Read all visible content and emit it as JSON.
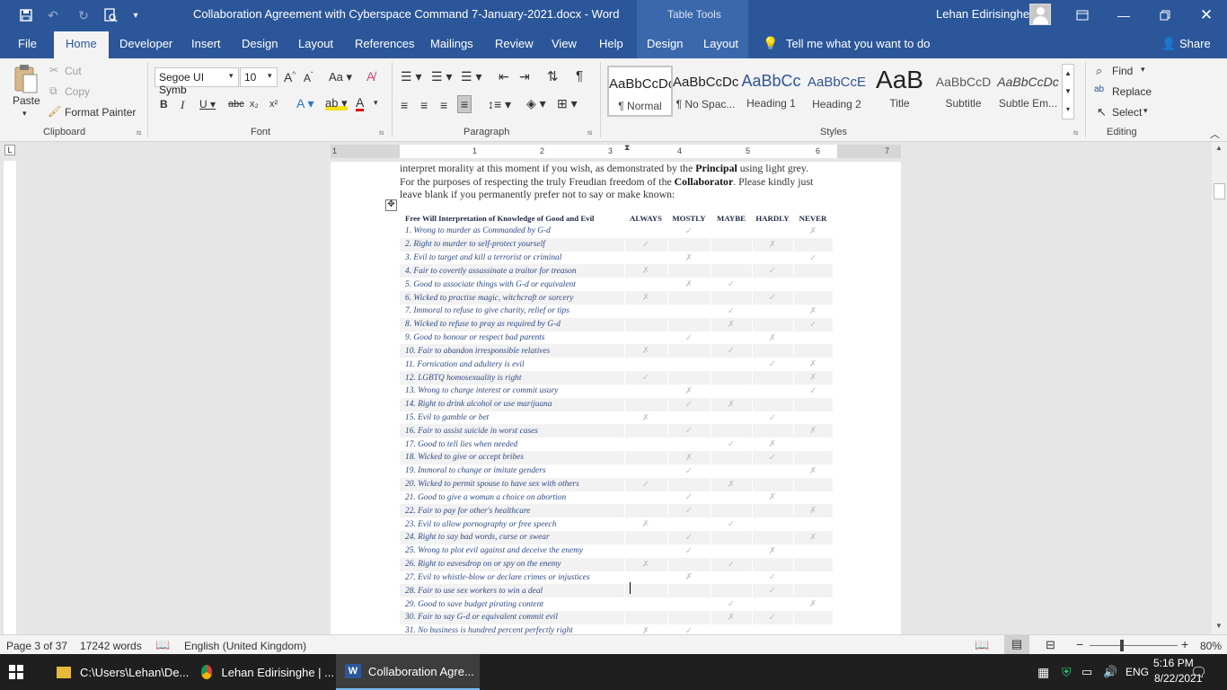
{
  "titlebar": {
    "doc_title": "Collaboration Agreement with Cyberspace Command 7-January-2021.docx  -  Word",
    "table_tools": "Table Tools",
    "user_name": "Lehan Edirisinghe"
  },
  "tabs": [
    "File",
    "Home",
    "Developer",
    "Insert",
    "Design",
    "Layout",
    "References",
    "Mailings",
    "Review",
    "View",
    "Help",
    "Design",
    "Layout"
  ],
  "tell_me": "Tell me what you want to do",
  "share": "Share",
  "clipboard": {
    "paste": "Paste",
    "cut": "Cut",
    "copy": "Copy",
    "format_painter": "Format Painter",
    "label": "Clipboard"
  },
  "font": {
    "name": "Segoe UI Symb",
    "size": "10",
    "label": "Font"
  },
  "paragraph": {
    "label": "Paragraph"
  },
  "styles": {
    "label": "Styles",
    "items": [
      {
        "preview": "AaBbCcDc",
        "name": "¶ Normal"
      },
      {
        "preview": "AaBbCcDc",
        "name": "¶ No Spac..."
      },
      {
        "preview": "AaBbCc",
        "name": "Heading 1"
      },
      {
        "preview": "AaBbCcE",
        "name": "Heading 2"
      },
      {
        "preview": "AaB",
        "name": "Title"
      },
      {
        "preview": "AaBbCcD",
        "name": "Subtitle"
      },
      {
        "preview": "AaBbCcDc",
        "name": "Subtle Em..."
      }
    ]
  },
  "editing": {
    "find": "Find",
    "replace": "Replace",
    "select": "Select",
    "label": "Editing"
  },
  "document": {
    "para_line1_pre": "interpret morality at this moment if you wish, as demonstrated by the ",
    "principal": "Principal",
    "para_line1_post": " using light grey.",
    "para_line2_pre": "For the purposes of respecting the truly Freudian freedom of the ",
    "collaborator": "Collaborator",
    "para_line2_post": ". Please kindly just",
    "para_line3": "leave blank if you permanently prefer not to say or make known:",
    "table_headers": [
      "Free Will Interpretation of Knowledge of Good and Evil",
      "ALWAYS",
      "MOSTLY",
      "MAYBE",
      "HARDLY",
      "NEVER"
    ],
    "rows": [
      {
        "q": "1. Wrong to murder as Commanded by G-d",
        "marks": [
          "",
          "✓",
          "",
          "",
          "✗"
        ]
      },
      {
        "q": "2. Right to murder to self-protect yourself",
        "marks": [
          "✓",
          "",
          "",
          "✗",
          ""
        ]
      },
      {
        "q": "3. Evil to target and kill a terrorist or criminal",
        "marks": [
          "",
          "✗",
          "",
          "",
          "✓"
        ]
      },
      {
        "q": "4. Fair to covertly assassinate a traitor for treason",
        "marks": [
          "✗",
          "",
          "",
          "✓",
          ""
        ]
      },
      {
        "q": "5. Good to associate things with G-d or equivalent",
        "marks": [
          "",
          "✗",
          "✓",
          "",
          ""
        ]
      },
      {
        "q": "6. Wicked to practise magic, witchcraft or sorcery",
        "marks": [
          "✗",
          "",
          "",
          "✓",
          ""
        ]
      },
      {
        "q": "7. Immoral to refuse to give charity, relief or tips",
        "marks": [
          "",
          "",
          "✓",
          "",
          "✗"
        ]
      },
      {
        "q": "8. Wicked to refuse to pray as required by G-d",
        "marks": [
          "",
          "",
          "✗",
          "",
          "✓"
        ]
      },
      {
        "q": "9. Good to honour or respect bad parents",
        "marks": [
          "",
          "✓",
          "",
          "✗",
          ""
        ]
      },
      {
        "q": "10. Fair to abandon irresponsible relatives",
        "marks": [
          "✗",
          "",
          "✓",
          "",
          ""
        ]
      },
      {
        "q": "11. Fornication and adultery is evil",
        "marks": [
          "",
          "",
          "",
          "✓",
          "✗"
        ]
      },
      {
        "q": "12. LGBTQ homosexuality is right",
        "marks": [
          "✓",
          "",
          "",
          "",
          "✗"
        ]
      },
      {
        "q": "13. Wrong to charge interest or commit usury",
        "marks": [
          "",
          "✗",
          "",
          "",
          "✓"
        ]
      },
      {
        "q": "14. Right to drink alcohol or use marijuana",
        "marks": [
          "",
          "✓",
          "✗",
          "",
          ""
        ]
      },
      {
        "q": "15. Evil to gamble or bet",
        "marks": [
          "✗",
          "",
          "",
          "✓",
          ""
        ]
      },
      {
        "q": "16. Fair to assist suicide in worst cases",
        "marks": [
          "",
          "✓",
          "",
          "",
          "✗"
        ]
      },
      {
        "q": "17. Good to tell lies when needed",
        "marks": [
          "",
          "",
          "✓",
          "✗",
          ""
        ]
      },
      {
        "q": "18. Wicked to give or accept bribes",
        "marks": [
          "",
          "✗",
          "",
          "✓",
          ""
        ]
      },
      {
        "q": "19. Immoral to change or imitate genders",
        "marks": [
          "",
          "✓",
          "",
          "",
          "✗"
        ]
      },
      {
        "q": "20. Wicked to permit spouse to have sex with others",
        "marks": [
          "✓",
          "",
          "✗",
          "",
          ""
        ]
      },
      {
        "q": "21. Good to give a woman a choice on abortion",
        "marks": [
          "",
          "✓",
          "",
          "✗",
          ""
        ]
      },
      {
        "q": "22. Fair to pay for other's healthcare",
        "marks": [
          "",
          "✓",
          "",
          "",
          "✗"
        ]
      },
      {
        "q": "23. Evil to allow pornography or free speech",
        "marks": [
          "✗",
          "",
          "✓",
          "",
          ""
        ]
      },
      {
        "q": "24. Right to say bad words, curse or swear",
        "marks": [
          "",
          "✓",
          "",
          "",
          "✗"
        ]
      },
      {
        "q": "25. Wrong to plot evil against and deceive the enemy",
        "marks": [
          "",
          "✓",
          "",
          "✗",
          ""
        ]
      },
      {
        "q": "26. Right to eavesdrop on or spy on the enemy",
        "marks": [
          "✗",
          "",
          "✓",
          "",
          ""
        ]
      },
      {
        "q": "27. Evil to whistle-blow or declare crimes or injustices",
        "marks": [
          "",
          "✗",
          "",
          "✓",
          ""
        ]
      },
      {
        "q": "28. Fair to use sex workers to win a deal",
        "marks": [
          "",
          "",
          "",
          "✓",
          ""
        ]
      },
      {
        "q": "29. Good to save budget pirating content",
        "marks": [
          "",
          "",
          "✓",
          "",
          "✗"
        ]
      },
      {
        "q": "30. Fair to say G-d or equivalent commit evil",
        "marks": [
          "",
          "",
          "✗",
          "✓",
          ""
        ]
      },
      {
        "q": "31. No business is hundred percent perfectly right",
        "marks": [
          "✗",
          "✓",
          "",
          "",
          ""
        ]
      }
    ]
  },
  "ruler_numbers": [
    "1",
    "1",
    "2",
    "3",
    "4",
    "5",
    "6",
    "7"
  ],
  "status": {
    "page": "Page 3 of 37",
    "words": "17242 words",
    "language": "English (United Kingdom)",
    "zoom": "80%"
  },
  "taskbar": {
    "apps": [
      "C:\\Users\\Lehan\\De...",
      "Lehan Edirisinghe | ...",
      "Collaboration Agre..."
    ],
    "time": "5:16 PM",
    "date": "8/22/2021"
  }
}
